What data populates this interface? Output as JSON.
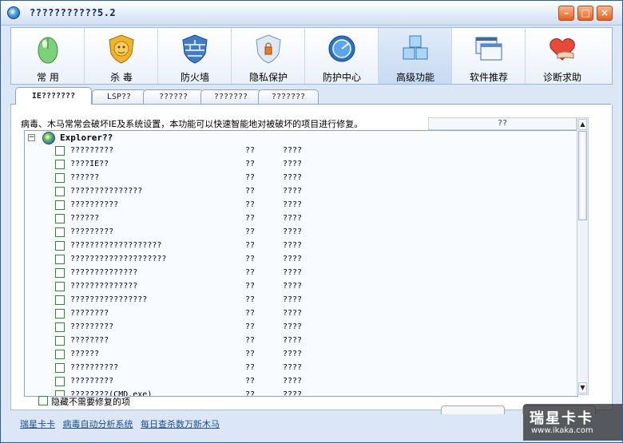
{
  "window": {
    "title": "???????????5.2"
  },
  "toolbar": {
    "items": [
      {
        "label": "常 用",
        "icon": "mouse-icon"
      },
      {
        "label": "杀 毒",
        "icon": "lion-shield-icon"
      },
      {
        "label": "防火墙",
        "icon": "firewall-shield-icon"
      },
      {
        "label": "隐私保护",
        "icon": "privacy-shield-icon"
      },
      {
        "label": "防护中心",
        "icon": "protection-center-icon"
      },
      {
        "label": "高级功能",
        "icon": "advanced-cubes-icon"
      },
      {
        "label": "软件推荐",
        "icon": "software-windows-icon"
      },
      {
        "label": "诊断求助",
        "icon": "heart-hands-icon"
      }
    ],
    "active_index": 5
  },
  "tabs": [
    {
      "label": "IE???????"
    },
    {
      "label": "LSP??"
    },
    {
      "label": "??????"
    },
    {
      "label": "???????"
    },
    {
      "label": "???????"
    }
  ],
  "content": {
    "description": "病毒、木马常常会破坏IE及系统设置，本功能可以快速智能地对被破坏的项目进行修复。",
    "column_header": "??",
    "root_label": "Explorer??",
    "rows": [
      {
        "name": "?????????",
        "col1": "??",
        "col2": "????"
      },
      {
        "name": "????IE??",
        "col1": "??",
        "col2": "????"
      },
      {
        "name": "??????",
        "col1": "??",
        "col2": "????"
      },
      {
        "name": "???????????????",
        "col1": "??",
        "col2": "????"
      },
      {
        "name": "??????????",
        "col1": "??",
        "col2": "????"
      },
      {
        "name": "??????",
        "col1": "??",
        "col2": "????"
      },
      {
        "name": "?????????",
        "col1": "??",
        "col2": "????"
      },
      {
        "name": "???????????????????",
        "col1": "??",
        "col2": "????"
      },
      {
        "name": "????????????????????",
        "col1": "??",
        "col2": "????"
      },
      {
        "name": "??????????????",
        "col1": "??",
        "col2": "????"
      },
      {
        "name": "??????????????",
        "col1": "??",
        "col2": "????"
      },
      {
        "name": "????????????????",
        "col1": "??",
        "col2": "????"
      },
      {
        "name": "????????",
        "col1": "??",
        "col2": "????"
      },
      {
        "name": "?????????",
        "col1": "??",
        "col2": "????"
      },
      {
        "name": "????????",
        "col1": "??",
        "col2": "????"
      },
      {
        "name": "??????",
        "col1": "??",
        "col2": "????"
      },
      {
        "name": "??????????",
        "col1": "??",
        "col2": "????"
      },
      {
        "name": "?????????",
        "col1": "??",
        "col2": "????"
      },
      {
        "name": "????????(CMD.exe)",
        "col1": "??",
        "col2": "????"
      }
    ],
    "hide_option": "隐藏不需要修复的项"
  },
  "status": {
    "links": [
      "瑞星卡卡",
      "病毒自动分析系统",
      "每日查杀数万新木马"
    ]
  },
  "watermark": {
    "big": "瑞星卡卡",
    "small": "www.ikaka.com"
  },
  "colors": {
    "accent": "#2c5d9f",
    "checkbox": "#2f8a2f",
    "link": "#1a4d8f"
  }
}
